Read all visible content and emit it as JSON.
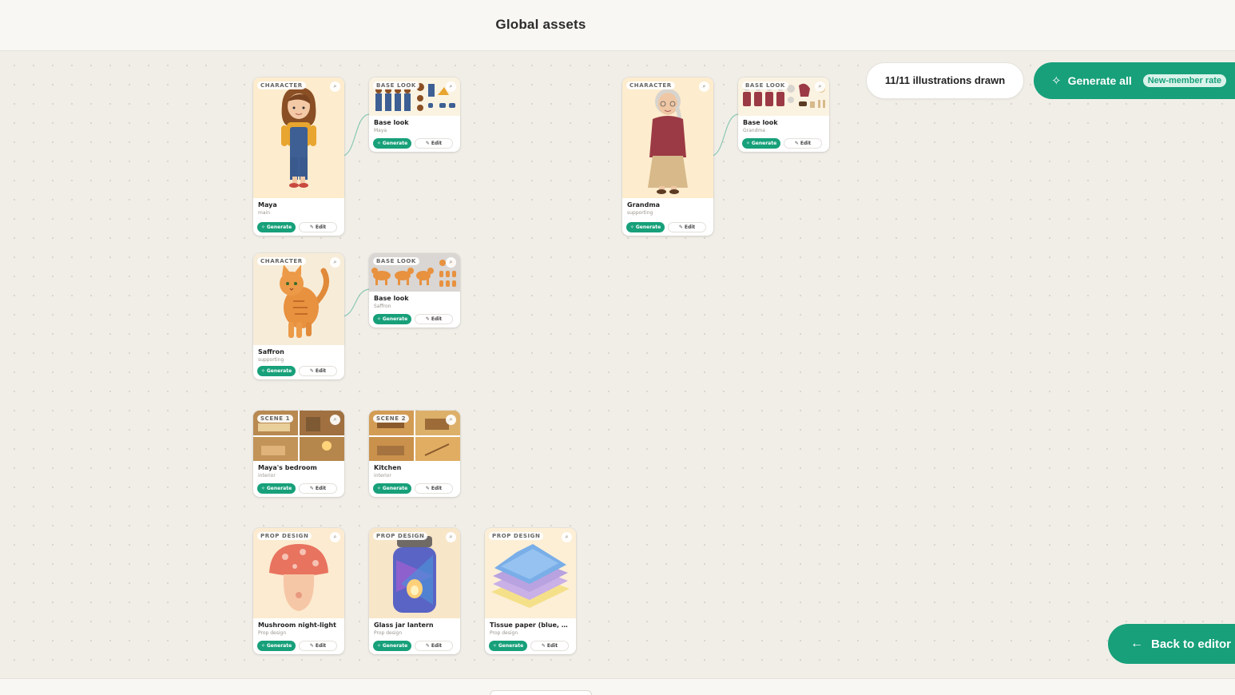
{
  "header": {
    "title": "Global assets"
  },
  "toolbar": {
    "count_label": "11/11 illustrations drawn",
    "generate_all_label": "Generate all",
    "generate_all_badge": "New-member rate",
    "back_label": "Back to editor"
  },
  "colors": {
    "accent": "#17a07a",
    "canvas": "#f1eee8"
  },
  "buttons": {
    "generate": "Generate",
    "edit": "Edit"
  },
  "cards": {
    "maya": {
      "tag": "CHARACTER",
      "name": "Maya",
      "sub": "main"
    },
    "maya_base": {
      "tag": "BASE LOOK",
      "name": "Base look",
      "sub": "Maya"
    },
    "grandma": {
      "tag": "CHARACTER",
      "name": "Grandma",
      "sub": "supporting"
    },
    "grandma_base": {
      "tag": "BASE LOOK",
      "name": "Base look",
      "sub": "Grandma"
    },
    "saffron": {
      "tag": "CHARACTER",
      "name": "Saffron",
      "sub": "supporting"
    },
    "saffron_base": {
      "tag": "BASE LOOK",
      "name": "Base look",
      "sub": "Saffron"
    },
    "bedroom": {
      "tag": "SCENE 1",
      "name": "Maya's bedroom",
      "sub": "interior"
    },
    "kitchen": {
      "tag": "SCENE 2",
      "name": "Kitchen",
      "sub": "interior"
    },
    "mushroom": {
      "tag": "PROP DESIGN",
      "name": "Mushroom night-light",
      "sub": "Prop design"
    },
    "lantern": {
      "tag": "PROP DESIGN",
      "name": "Glass jar lantern",
      "sub": "Prop design"
    },
    "tissue": {
      "tag": "PROP DESIGN",
      "name": "Tissue paper (blue, pur...",
      "sub": "Prop design"
    }
  }
}
